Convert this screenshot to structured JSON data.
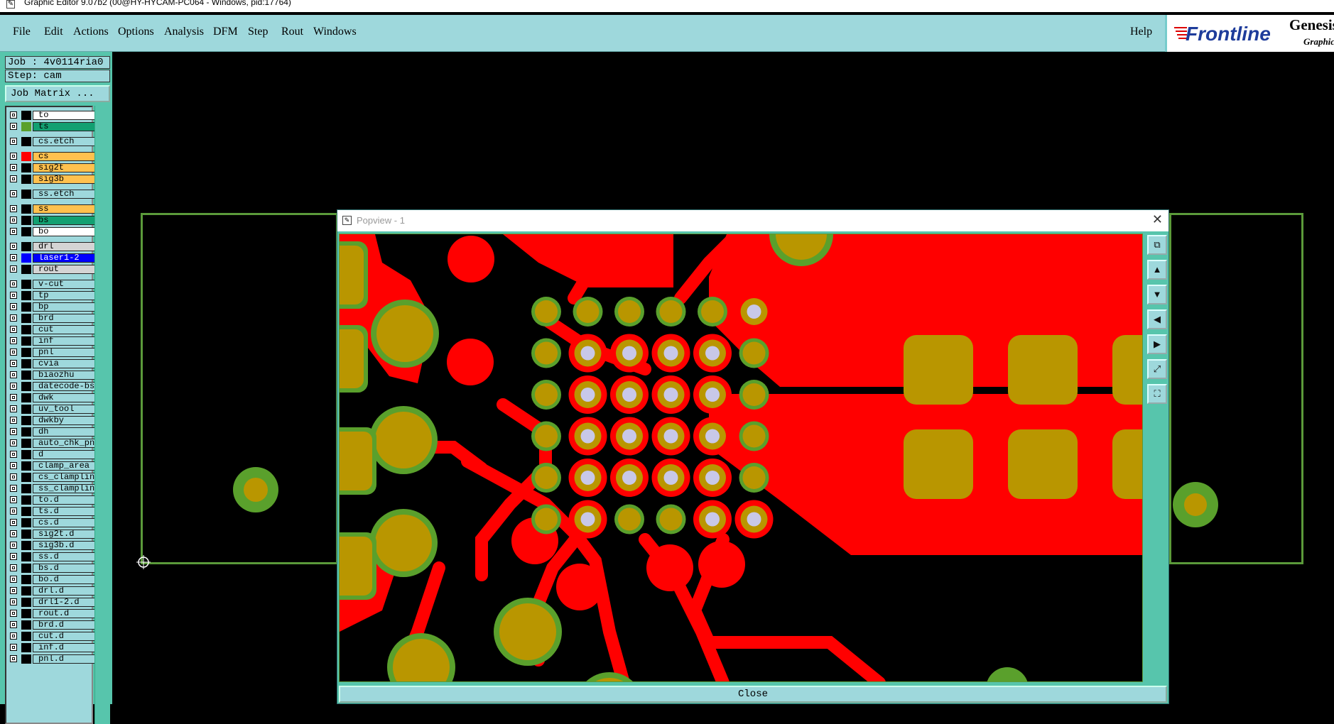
{
  "window": {
    "title": "Graphic Editor 9.07b2 (00@HY-HYCAM-PC064 - Windows, pid:17764)"
  },
  "menu": {
    "items": [
      {
        "label": "File"
      },
      {
        "label": "Edit"
      },
      {
        "label": "Actions"
      },
      {
        "label": "Options"
      },
      {
        "label": "Analysis"
      },
      {
        "label": "DFM"
      },
      {
        "label": "Step"
      },
      {
        "label": "Rout"
      },
      {
        "label": "Windows"
      }
    ],
    "help": "Help"
  },
  "brand": {
    "logo": "Frontline",
    "product": "Genesis",
    "sub": "Graphic"
  },
  "job": {
    "job_label": "Job : 4v0114ria0",
    "step_label": "Step: cam",
    "matrix_button": "Job Matrix ..."
  },
  "layers": [
    {
      "name": "to",
      "color": "#ffffff",
      "swatch": "#000000"
    },
    {
      "name": "ts",
      "color": "#12a071",
      "swatch": "#5aa02c"
    },
    {
      "name": "cs.etch",
      "color": "#9ed8dc",
      "swatch": "#000000"
    },
    {
      "name": "cs",
      "color": "#ffc14e",
      "swatch": "#ff0000"
    },
    {
      "name": "sig2t",
      "color": "#ffc14e",
      "swatch": "#000000"
    },
    {
      "name": "sig3b",
      "color": "#ffc14e",
      "swatch": "#000000"
    },
    {
      "name": "ss.etch",
      "color": "#9ed8dc",
      "swatch": "#000000"
    },
    {
      "name": "ss",
      "color": "#ffc14e",
      "swatch": "#000000"
    },
    {
      "name": "bs",
      "color": "#12a071",
      "swatch": "#000000"
    },
    {
      "name": "bo",
      "color": "#ffffff",
      "swatch": "#000000"
    },
    {
      "name": "drl",
      "color": "#d4d4d4",
      "swatch": "#000000"
    },
    {
      "name": "laser1-2",
      "color": "#0000ff",
      "swatch": "#0000ff",
      "text_color": "#ffffff"
    },
    {
      "name": "rout",
      "color": "#d4d4d4",
      "swatch": "#000000"
    },
    {
      "name": "v-cut",
      "color": "#9ed8dc",
      "swatch": "#000000"
    },
    {
      "name": "tp",
      "color": "#9ed8dc",
      "swatch": "#000000"
    },
    {
      "name": "bp",
      "color": "#9ed8dc",
      "swatch": "#000000"
    },
    {
      "name": "brd",
      "color": "#9ed8dc",
      "swatch": "#000000"
    },
    {
      "name": "cut",
      "color": "#9ed8dc",
      "swatch": "#000000"
    },
    {
      "name": "inf",
      "color": "#9ed8dc",
      "swatch": "#000000"
    },
    {
      "name": "pnl",
      "color": "#9ed8dc",
      "swatch": "#000000"
    },
    {
      "name": "cvia",
      "color": "#9ed8dc",
      "swatch": "#000000"
    },
    {
      "name": "biaozhu",
      "color": "#9ed8dc",
      "swatch": "#000000"
    },
    {
      "name": "datecode-bs",
      "color": "#9ed8dc",
      "swatch": "#000000"
    },
    {
      "name": "dwk",
      "color": "#9ed8dc",
      "swatch": "#000000"
    },
    {
      "name": "uv_tool",
      "color": "#9ed8dc",
      "swatch": "#000000"
    },
    {
      "name": "dwkby",
      "color": "#9ed8dc",
      "swatch": "#000000"
    },
    {
      "name": "dh",
      "color": "#9ed8dc",
      "swatch": "#000000"
    },
    {
      "name": "auto_chk_pnl",
      "color": "#9ed8dc",
      "swatch": "#000000"
    },
    {
      "name": "d",
      "color": "#9ed8dc",
      "swatch": "#000000"
    },
    {
      "name": "clamp_area",
      "color": "#9ed8dc",
      "swatch": "#000000"
    },
    {
      "name": "cs_clampline",
      "color": "#9ed8dc",
      "swatch": "#000000"
    },
    {
      "name": "ss_clampline",
      "color": "#9ed8dc",
      "swatch": "#000000"
    },
    {
      "name": "to.d",
      "color": "#9ed8dc",
      "swatch": "#000000"
    },
    {
      "name": "ts.d",
      "color": "#9ed8dc",
      "swatch": "#000000"
    },
    {
      "name": "cs.d",
      "color": "#9ed8dc",
      "swatch": "#000000"
    },
    {
      "name": "sig2t.d",
      "color": "#9ed8dc",
      "swatch": "#000000"
    },
    {
      "name": "sig3b.d",
      "color": "#9ed8dc",
      "swatch": "#000000"
    },
    {
      "name": "ss.d",
      "color": "#9ed8dc",
      "swatch": "#000000"
    },
    {
      "name": "bs.d",
      "color": "#9ed8dc",
      "swatch": "#000000"
    },
    {
      "name": "bo.d",
      "color": "#9ed8dc",
      "swatch": "#000000"
    },
    {
      "name": "drl.d",
      "color": "#9ed8dc",
      "swatch": "#000000"
    },
    {
      "name": "drl1-2.d",
      "color": "#9ed8dc",
      "swatch": "#000000"
    },
    {
      "name": "rout.d",
      "color": "#9ed8dc",
      "swatch": "#000000"
    },
    {
      "name": "brd.d",
      "color": "#9ed8dc",
      "swatch": "#000000"
    },
    {
      "name": "cut.d",
      "color": "#9ed8dc",
      "swatch": "#000000"
    },
    {
      "name": "inf.d",
      "color": "#9ed8dc",
      "swatch": "#000000"
    },
    {
      "name": "pnl.d",
      "color": "#9ed8dc",
      "swatch": "#000000"
    }
  ],
  "popview": {
    "title": "Popview - 1",
    "close_label": "Close",
    "tools": [
      "zoom-window-icon",
      "pan-up-icon",
      "pan-down-icon",
      "pan-left-icon",
      "pan-right-icon",
      "zoom-fit-icon",
      "zoom-home-icon"
    ]
  },
  "colors": {
    "copper": "#ff0000",
    "pad": "#b99600",
    "mask": "#5aa02c",
    "drill": "#c8c8e8",
    "outline": "#5b9a3a",
    "panel": "#9ed8dc",
    "panel_dark": "#57c5ac"
  }
}
